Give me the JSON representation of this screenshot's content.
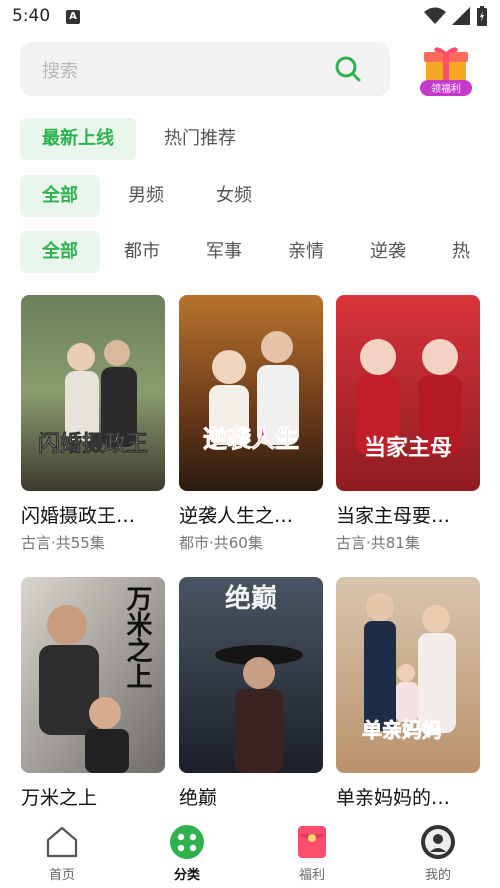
{
  "status_bar": {
    "time": "5:40",
    "notif_letter": "A"
  },
  "search": {
    "placeholder": "搜索"
  },
  "gift": {
    "label": "领福利"
  },
  "filters": {
    "row1": [
      "最新上线",
      "热门推荐"
    ],
    "row2": [
      "全部",
      "男频",
      "女频"
    ],
    "row3": [
      "全部",
      "都市",
      "军事",
      "亲情",
      "逆袭",
      "热"
    ]
  },
  "cards": [
    {
      "title": "闪婚摄政王…",
      "sub": "古言·共55集",
      "poster_text": "闪婚摄政王"
    },
    {
      "title": "逆袭人生之…",
      "sub": "都市·共60集",
      "poster_text": "逆袭人生"
    },
    {
      "title": "当家主母要…",
      "sub": "古言·共81集",
      "poster_text": "当家主母"
    },
    {
      "title": "万米之上",
      "sub": "",
      "poster_text": "万米之上"
    },
    {
      "title": "绝巅",
      "sub": "",
      "poster_text": "绝巅"
    },
    {
      "title": "单亲妈妈的…",
      "sub": "",
      "poster_text": "单亲妈妈"
    }
  ],
  "nav": [
    {
      "label": "首页",
      "icon": "home-icon"
    },
    {
      "label": "分类",
      "icon": "category-icon"
    },
    {
      "label": "福利",
      "icon": "gift-envelope-icon"
    },
    {
      "label": "我的",
      "icon": "profile-icon"
    }
  ],
  "colors": {
    "accent": "#2fb14e",
    "chip_bg": "#e8f6ec"
  }
}
